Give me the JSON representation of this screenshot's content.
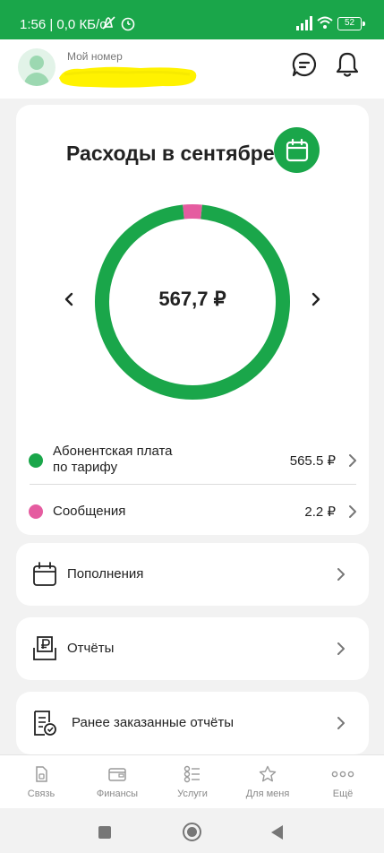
{
  "status_bar": {
    "time_and_data": "1:56 | 0,0 КБ/с",
    "battery": "52",
    "icons": [
      "mute-icon",
      "alarm-icon",
      "signal-icon",
      "wifi-icon",
      "battery-icon"
    ]
  },
  "header": {
    "my_number_label": "Мой номер",
    "icons": [
      "avatar-icon",
      "chat-icon",
      "bell-icon"
    ]
  },
  "expenses": {
    "title": "Расходы в сентябре",
    "total": "567,7 ₽",
    "rows": [
      {
        "label_line1": "Абонентская плата",
        "label_line2": "по тарифу",
        "amount": "565.5 ₽",
        "value": 565.5,
        "color": "#1aa64a"
      },
      {
        "label_line1": "Сообщения",
        "label_line2": "",
        "amount": "2.2 ₽",
        "value": 2.2,
        "color": "#e55ca0"
      }
    ]
  },
  "menu": [
    {
      "label": "Пополнения",
      "icon": "calendar-icon"
    },
    {
      "label": "Отчёты",
      "icon": "report-ruble-icon"
    },
    {
      "label": "Ранее заказанные отчёты",
      "icon": "document-check-icon"
    }
  ],
  "bottom_nav": [
    {
      "label": "Связь",
      "icon": "sim-icon"
    },
    {
      "label": "Финансы",
      "icon": "wallet-icon"
    },
    {
      "label": "Услуги",
      "icon": "services-list-icon"
    },
    {
      "label": "Для меня",
      "icon": "star-icon"
    },
    {
      "label": "Ещё",
      "icon": "more-dots-icon"
    }
  ],
  "colors": {
    "brand_green": "#1aa64a",
    "messages_pink": "#e55ca0",
    "redaction_yellow": "#fff200"
  }
}
